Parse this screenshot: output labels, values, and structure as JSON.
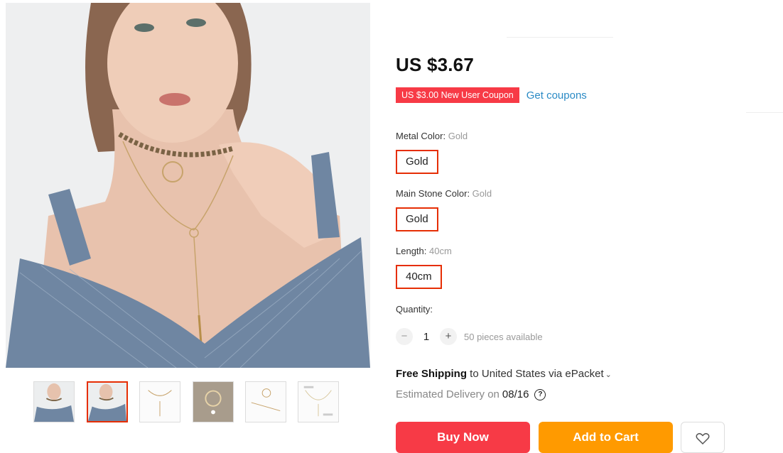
{
  "product": {
    "price": "US $3.67",
    "coupon_badge": "US $3.00 New User Coupon",
    "get_coupons_label": "Get coupons"
  },
  "properties": [
    {
      "label": "Metal Color: ",
      "value": "Gold",
      "option": "Gold"
    },
    {
      "label": "Main Stone Color: ",
      "value": "Gold",
      "option": "Gold"
    },
    {
      "label": "Length: ",
      "value": "40cm",
      "option": "40cm"
    }
  ],
  "quantity": {
    "label": "Quantity:",
    "minus": "−",
    "value": "1",
    "plus": "+",
    "available": "50 pieces available"
  },
  "shipping": {
    "free_label": "Free Shipping",
    "destination": " to United States via ePacket",
    "chevron": "⌄",
    "delivery_label": "Estimated Delivery on",
    "delivery_date": "08/16",
    "help_glyph": "?"
  },
  "actions": {
    "buy_now": "Buy Now",
    "add_to_cart": "Add to Cart",
    "wishlist_icon": "heart-icon"
  },
  "gallery": {
    "thumbnail_count": 6,
    "active_index": 1
  },
  "colors": {
    "accent_red": "#f73a46",
    "selected_border": "#e62e04",
    "cart_orange": "#ff9a00",
    "link_blue": "#2a8ac5"
  }
}
